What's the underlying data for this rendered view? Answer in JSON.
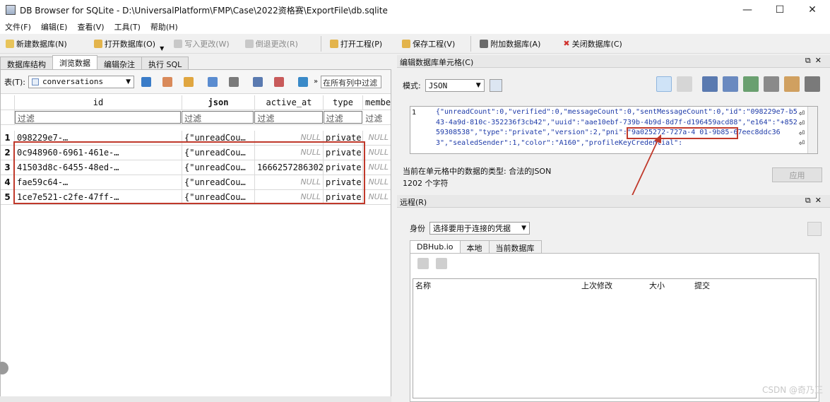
{
  "window": {
    "title": "DB Browser for SQLite - D:\\UniversalPlatform\\FMP\\Case\\2022资格赛\\ExportFile\\db.sqlite",
    "minimize": "—",
    "maximize": "☐",
    "close": "✕"
  },
  "menu": [
    "文件(F)",
    "编辑(E)",
    "查看(V)",
    "工具(T)",
    "帮助(H)"
  ],
  "toolbar": {
    "new_db": "新建数据库(N)",
    "open_db": "打开数据库(O)",
    "write_changes": "写入更改(W)",
    "revert_changes": "倒退更改(R)",
    "open_project": "打开工程(P)",
    "save_project": "保存工程(V)",
    "attach_db": "附加数据库(A)",
    "close_db": "关闭数据库(C)"
  },
  "left_tabs": [
    "数据库结构",
    "浏览数据",
    "编辑杂注",
    "执行 SQL"
  ],
  "table_toolbar": {
    "table_label": "表(T):",
    "table_name": "conversations",
    "filter_all_placeholder": "在所有列中过滤"
  },
  "grid": {
    "columns": [
      "id",
      "json",
      "active_at",
      "type",
      "membe"
    ],
    "filter_placeholder": "过滤",
    "null_text": "NULL",
    "rows": [
      {
        "num": "1",
        "id": "098229e7-…",
        "json": "{\"unreadCou…",
        "active_at": "",
        "type": "private",
        "member": ""
      },
      {
        "num": "2",
        "id": "0c948960-6961-461e-…",
        "json": "{\"unreadCou…",
        "active_at": "",
        "type": "private",
        "member": ""
      },
      {
        "num": "3",
        "id": "41503d8c-6455-48ed-…",
        "json": "{\"unreadCou…",
        "active_at": "1666257286302",
        "type": "private",
        "member": ""
      },
      {
        "num": "4",
        "id": "fae59c64-…",
        "json": "{\"unreadCou…",
        "active_at": "",
        "type": "private",
        "member": ""
      },
      {
        "num": "5",
        "id": "1ce7e521-c2fe-47ff-…",
        "json": "{\"unreadCou…",
        "active_at": "",
        "type": "private",
        "member": ""
      }
    ]
  },
  "editor": {
    "dock_title": "编辑数据库单元格(C)",
    "mode_label": "模式:",
    "mode_value": "JSON",
    "line_number": "1",
    "json_text": "{\"unreadCount\":0,\"verified\":0,\"messageCount\":0,\"sentMessageCount\":0,\"id\":\"098229e7-b543-4a9d-810c-352236f3cb42\",\"uuid\":\"aae10ebf-739b-4b9d-8d7f-d196459acd88\",\"e164\":\"+85259308538\",\"type\":\"private\",\"version\":2,\"pni\":\"9a025272-727a-4 01-9b85-67eec8ddc363\",\"sealedSender\":1,\"color\":\"A160\",\"profileKeyCredential\":",
    "type_info": "当前在单元格中的数据的类型: 合法的JSON",
    "char_count": "1202 个字符",
    "apply": "应用"
  },
  "remote": {
    "dock_title": "远程(R)",
    "identity_label": "身份",
    "identity_value": "选择要用于连接的凭据",
    "tabs": [
      "DBHub.io",
      "本地",
      "当前数据库"
    ],
    "columns": [
      "名称",
      "上次修改",
      "大小",
      "提交"
    ]
  },
  "watermark": "CSDN @奇乃正"
}
